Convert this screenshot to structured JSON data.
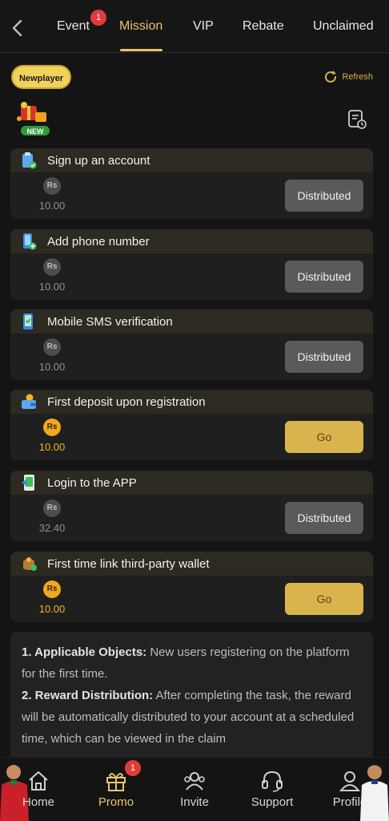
{
  "tabs": [
    {
      "label": "Event",
      "badge": "1"
    },
    {
      "label": "Mission"
    },
    {
      "label": "VIP"
    },
    {
      "label": "Rebate"
    },
    {
      "label": "Unclaimed"
    }
  ],
  "header": {
    "newplayer_label": "Newplayer",
    "refresh_label": "Refresh",
    "new_logo_text": "NEW"
  },
  "currency_symbol": "Rs",
  "tasks": [
    {
      "title": "Sign up an account",
      "amount": "10.00",
      "button": "Distributed",
      "status": "distributed",
      "icon": "clipboard-check-icon"
    },
    {
      "title": "Add phone number",
      "amount": "10.00",
      "button": "Distributed",
      "status": "distributed",
      "icon": "phone-add-icon"
    },
    {
      "title": "Mobile SMS verification",
      "amount": "10.00",
      "button": "Distributed",
      "status": "distributed",
      "icon": "sms-verify-icon"
    },
    {
      "title": "First deposit upon registration",
      "amount": "10.00",
      "button": "Go",
      "status": "available",
      "icon": "deposit-wallet-icon"
    },
    {
      "title": "Login to the APP",
      "amount": "32.40",
      "button": "Distributed",
      "status": "distributed",
      "icon": "app-login-icon"
    },
    {
      "title": "First time link third-party wallet",
      "amount": "10.00",
      "button": "Go",
      "status": "available",
      "icon": "wallet-link-icon"
    }
  ],
  "info": {
    "p1_label": "1. Applicable Objects:",
    "p1_text": " New users registering on the platform for the first time.",
    "p2_label": "2. Reward Distribution:",
    "p2_text": " After completing the task, the reward will be automatically distributed to your account at a scheduled time, which can be viewed in the claim"
  },
  "bottom_nav": [
    {
      "label": "Home",
      "icon": "home-icon"
    },
    {
      "label": "Promo",
      "icon": "gift-icon",
      "badge": "1"
    },
    {
      "label": "Invite",
      "icon": "invite-icon"
    },
    {
      "label": "Support",
      "icon": "headset-icon"
    },
    {
      "label": "Profile",
      "icon": "profile-icon"
    }
  ],
  "colors": {
    "accent": "#e8c56a",
    "go_button": "#d9b34c",
    "distributed_button": "#5a5a5a",
    "badge": "#e23b3b",
    "gold_coin": "#f2a81d"
  }
}
